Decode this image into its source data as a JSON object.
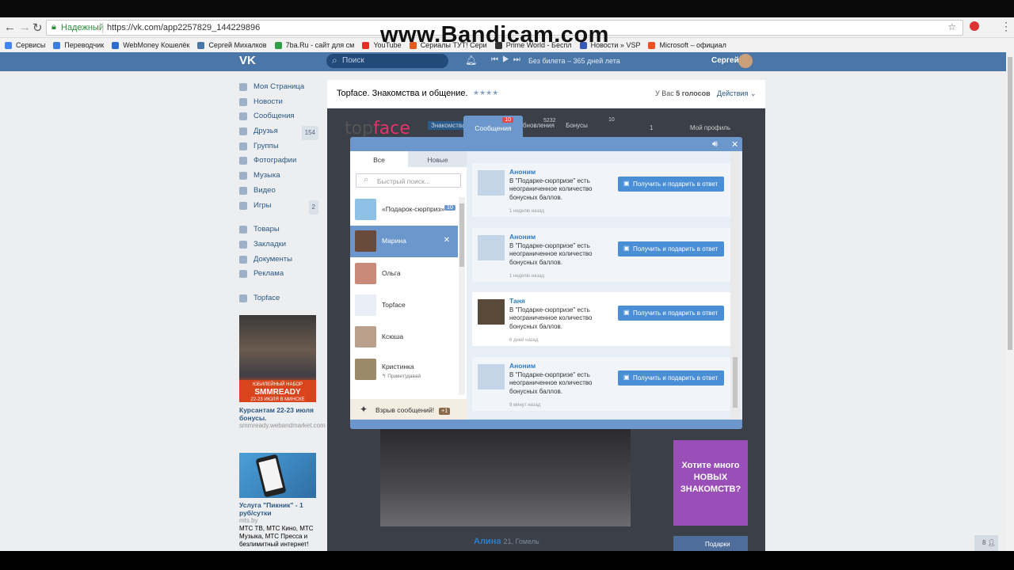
{
  "browser": {
    "secure_label": "Надежный",
    "url": "https://vk.com/app2257829_144229896"
  },
  "bookmarks": [
    {
      "label": "Сервисы",
      "color": "#4285f4"
    },
    {
      "label": "Переводчик",
      "color": "#3b7de0"
    },
    {
      "label": "WebMoney Кошелёк",
      "color": "#2a6fd0"
    },
    {
      "label": "Сергей Михалков",
      "color": "#4a76a8"
    },
    {
      "label": "7ba.Ru - сайт для см",
      "color": "#2f9e44"
    },
    {
      "label": "YouTube",
      "color": "#e52d27"
    },
    {
      "label": "Сериалы ТУТ! Сери",
      "color": "#e25a1c"
    },
    {
      "label": "Prime World - Беспл",
      "color": "#333333"
    },
    {
      "label": "Новости » VSP",
      "color": "#3a5ab8"
    },
    {
      "label": "Microsoft – официал",
      "color": "#f25022"
    }
  ],
  "watermark": "www.Bandicam.com",
  "vk": {
    "logo": "VK",
    "search_placeholder": "Поиск",
    "song": "Без билета – 365 дней лета",
    "user": "Сергей",
    "nav": [
      {
        "label": "Моя Страница"
      },
      {
        "label": "Новости"
      },
      {
        "label": "Сообщения"
      },
      {
        "label": "Друзья",
        "count": "154"
      },
      {
        "label": "Группы"
      },
      {
        "label": "Фотографии"
      },
      {
        "label": "Музыка"
      },
      {
        "label": "Видео"
      },
      {
        "label": "Игры",
        "count": "2"
      }
    ],
    "nav2": [
      {
        "label": "Товары"
      },
      {
        "label": "Закладки"
      },
      {
        "label": "Документы"
      },
      {
        "label": "Реклама"
      }
    ],
    "nav3": [
      {
        "label": "Topface"
      }
    ],
    "ad1": {
      "banner_small": "ЮБИЛЕЙНЫЙ НАБОР",
      "banner_big": "SMMREADY",
      "banner_sub": "22-23 ИЮЛЯ В МИНСКЕ",
      "title": "Курсантам 22-23 июля бонусы.",
      "domain": "smmready.webandmarket.com"
    },
    "ad2": {
      "title": "Услуга \"Пикник\" - 1 руб/сутки",
      "domain": "mts.by",
      "text": "МТС ТВ, МТС Кино, МТС Музыка, МТС Пресса и безлимитный интернет!"
    }
  },
  "app": {
    "title": "Topface. Знакомства и общение.",
    "stars": "★★★★",
    "votes_prefix": "У Вас ",
    "votes_count": "5 голосов",
    "actions": "Действия",
    "logo_a": "top",
    "logo_b": "face",
    "menu": [
      "Знакомства",
      "Обновления",
      "Бонусы"
    ],
    "updates_count": "5232",
    "bonus_count": "10",
    "coins": "1",
    "profile": "Мой профиль",
    "bg_name": "Алина",
    "bg_meta": "21, Гомель",
    "promo": "Хотите много НОВЫХ ЗНАКОМСТВ?",
    "promo2": "Подарки"
  },
  "messages_modal": {
    "tab_label": "Сообщения",
    "tab_badge": "10",
    "filter_all": "Все",
    "filter_new": "Новые",
    "search_placeholder": "Быстрый поиск...",
    "contacts": [
      {
        "name": "«Подарок-сюрприз»",
        "badge": "10",
        "color": "#8fc0e6"
      },
      {
        "name": "Марина",
        "selected": true,
        "color": "#6a4a3a"
      },
      {
        "name": "Ольга",
        "color": "#c98a7a"
      },
      {
        "name": "Topface",
        "color": "#e9eef6"
      },
      {
        "name": "Ксюша",
        "color": "#b8a08c"
      },
      {
        "name": "Кристинка",
        "sub": "↰ Привет)давай",
        "color": "#9a8a6a"
      }
    ],
    "bomb_label": "Взрыв сообщений!",
    "bomb_badge": "+1",
    "button_label": "Получить и подарить в ответ",
    "msg_text": "В \"Подарке-сюрпризе\" есть неограниченное количество бонусных баллов.",
    "items": [
      {
        "name": "Аноним",
        "time": "1 неделю назад"
      },
      {
        "name": "Аноним",
        "time": "1 неделю назад"
      },
      {
        "name": "Таня",
        "time": "6 дней назад"
      },
      {
        "name": "Аноним",
        "time": "9 минут назад"
      }
    ]
  }
}
